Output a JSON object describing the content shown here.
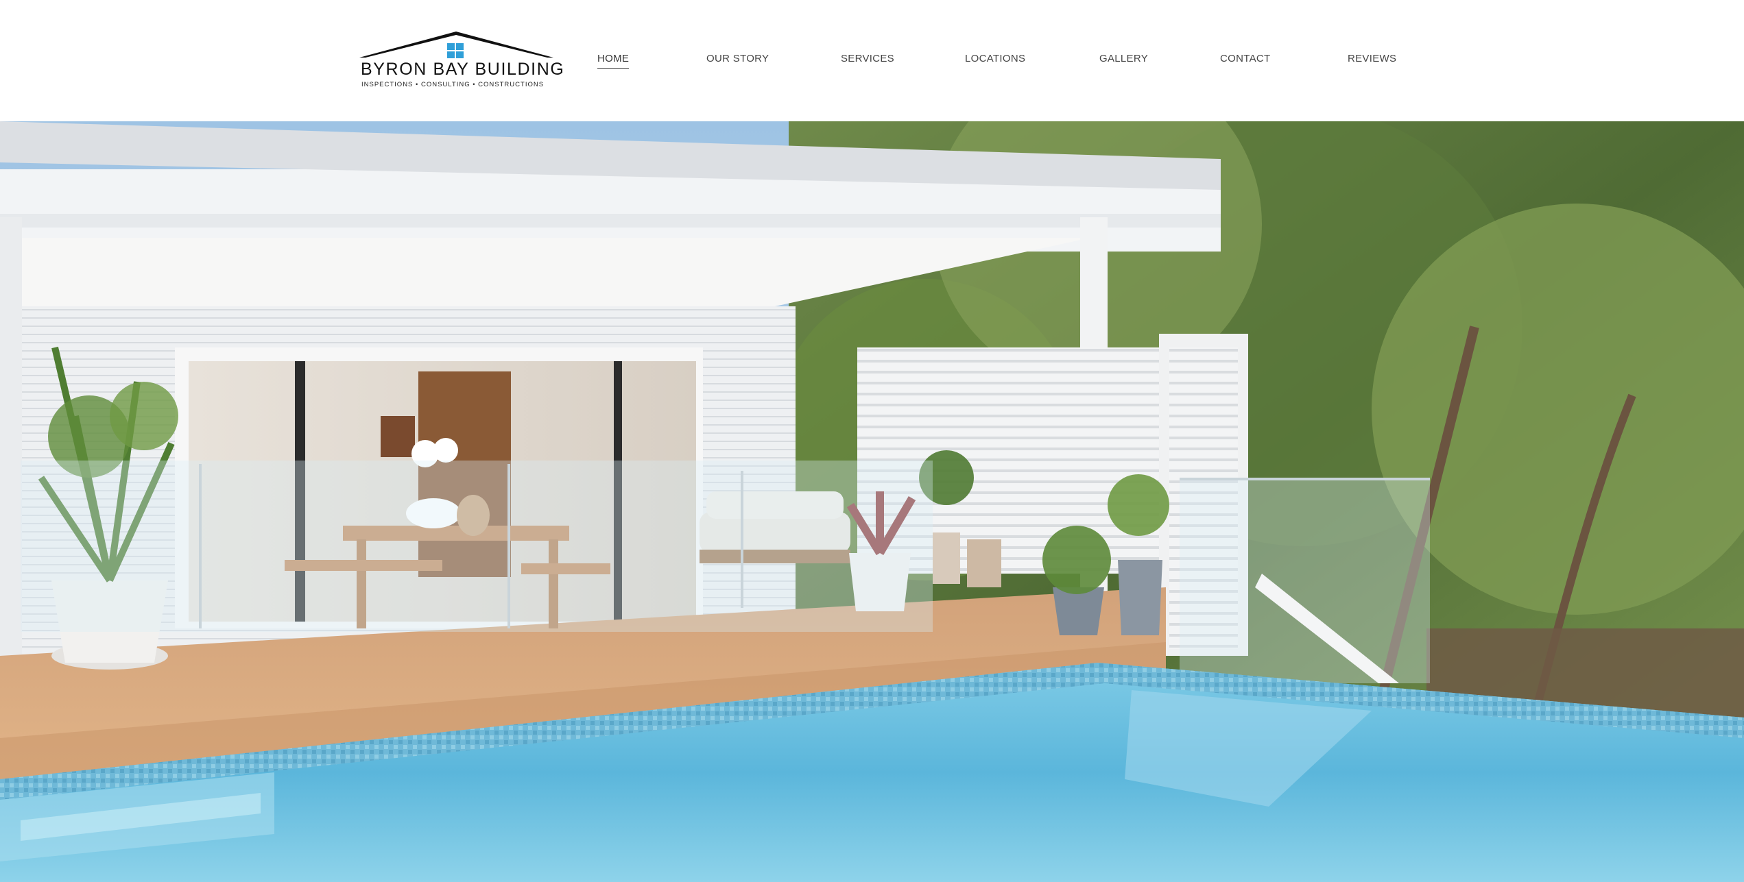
{
  "brand": {
    "name": "BYRON BAY BUILDING",
    "tagline": "INSPECTIONS • CONSULTING • CONSTRUCTIONS",
    "colors": {
      "roof": "#111111",
      "window": "#2f9fd8"
    }
  },
  "nav": {
    "items": [
      {
        "label": "HOME",
        "active": true
      },
      {
        "label": "OUR STORY",
        "active": false
      },
      {
        "label": "SERVICES",
        "active": false
      },
      {
        "label": "LOCATIONS",
        "active": false
      },
      {
        "label": "GALLERY",
        "active": false
      },
      {
        "label": "CONTACT",
        "active": false
      },
      {
        "label": "REVIEWS",
        "active": false
      }
    ]
  },
  "hero": {
    "image_subject": "covered timber deck with dining table, sofa, potted plants, glass pool fence and swimming pool"
  }
}
